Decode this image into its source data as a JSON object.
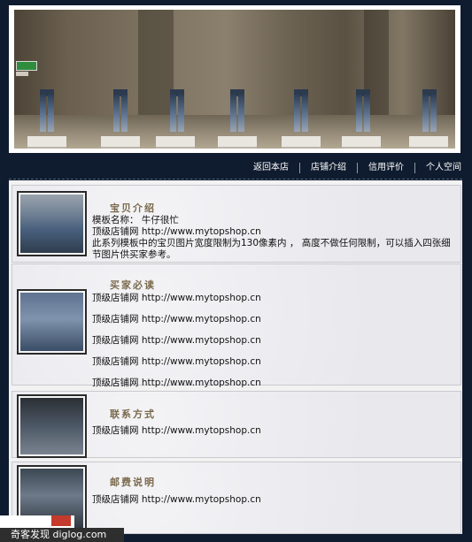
{
  "nav": {
    "items": [
      "返回本店",
      "店铺介绍",
      "信用评价",
      "个人空间"
    ]
  },
  "banner": {
    "exit_sign": "EXIT"
  },
  "sections": [
    {
      "title": "宝贝介绍",
      "lines": [
        "模板名称：  牛仔很忙",
        "顶级店铺网  http://www.mytopshop.cn"
      ],
      "paragraph": "此系列模板中的宝贝图片宽度限制为130像素内 ， 高度不做任何限制，可以插入四张细节图片供买家参考。"
    },
    {
      "title": "买家必读",
      "lines": [
        "顶级店铺网  http://www.mytopshop.cn",
        "顶级店铺网  http://www.mytopshop.cn",
        "顶级店铺网  http://www.mytopshop.cn",
        "顶级店铺网  http://www.mytopshop.cn",
        "顶级店铺网  http://www.mytopshop.cn"
      ]
    },
    {
      "title": "联系方式",
      "lines": [
        "顶级店铺网  http://www.mytopshop.cn"
      ]
    },
    {
      "title": "邮费说明",
      "lines": [
        "顶级店铺网  http://www.mytopshop.cn"
      ]
    }
  ],
  "watermark": {
    "site": "奇客发现  diglog.com"
  },
  "colors": {
    "background": "#0f1b2e",
    "panel": "#e8e8ed",
    "title": "#7a6a4c"
  }
}
